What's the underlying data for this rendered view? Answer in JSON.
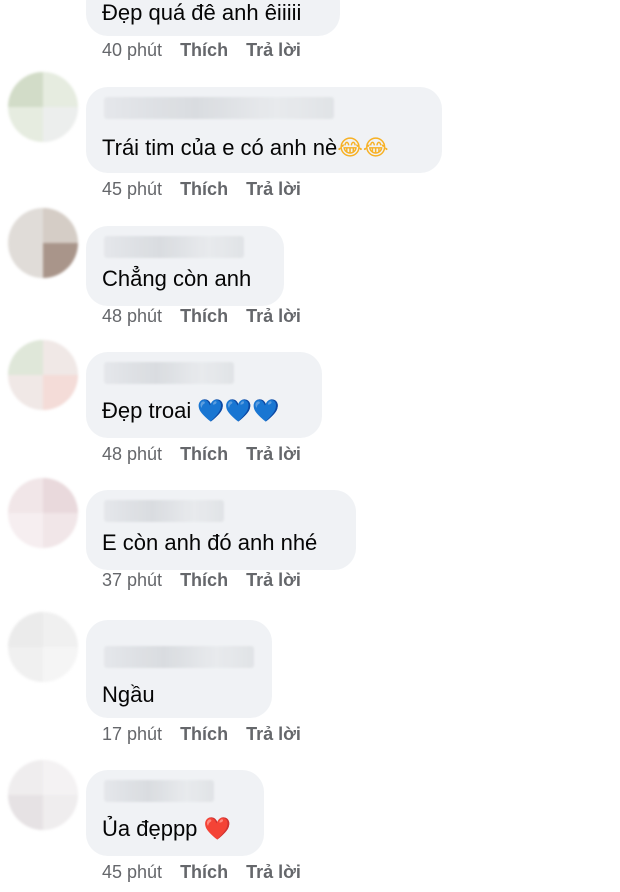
{
  "comments": [
    {
      "text": "Đẹp quá đê anh êiiiii",
      "time": "40 phút",
      "like": "Thích",
      "reply": "Trả lời",
      "emoji": ""
    },
    {
      "text": "Trái tim của e có anh nè",
      "time": "45 phút",
      "like": "Thích",
      "reply": "Trả lời",
      "emoji": "😂😂"
    },
    {
      "text": "Chẳng còn anh",
      "time": "48 phút",
      "like": "Thích",
      "reply": "Trả lời",
      "emoji": ""
    },
    {
      "text": "Đẹp troai ",
      "time": "48 phút",
      "like": "Thích",
      "reply": "Trả lời",
      "emoji": "💙💙💙"
    },
    {
      "text": "E còn anh đó anh nhé",
      "time": "37 phút",
      "like": "Thích",
      "reply": "Trả lời",
      "emoji": ""
    },
    {
      "text": "Ngầu",
      "time": "17 phút",
      "like": "Thích",
      "reply": "Trả lời",
      "emoji": ""
    },
    {
      "text": "Ủa đẹppp ",
      "time": "45 phút",
      "like": "Thích",
      "reply": "Trả lời",
      "emoji": "❤️"
    }
  ]
}
